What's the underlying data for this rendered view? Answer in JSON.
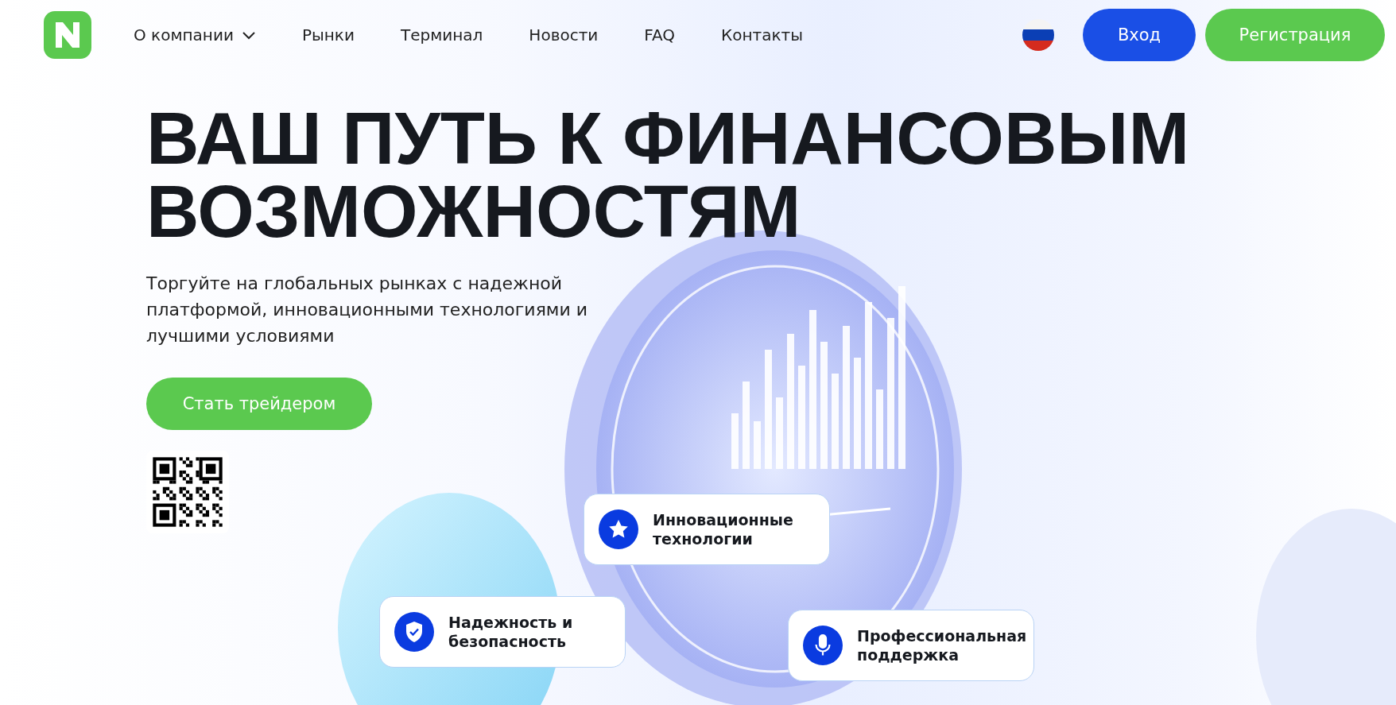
{
  "header": {
    "nav": [
      {
        "label": "О компании",
        "kind": "dropdown"
      },
      {
        "label": "Рынки",
        "kind": "link"
      },
      {
        "label": "Терминал",
        "kind": "link"
      },
      {
        "label": "Новости",
        "kind": "link"
      },
      {
        "label": "FAQ",
        "kind": "link"
      },
      {
        "label": "Контакты",
        "kind": "link"
      }
    ],
    "login": "Вход",
    "register": "Регистрация"
  },
  "hero": {
    "title_lines": [
      "ВАШ ПУТЬ К ФИНАНСОВЫМ",
      "ВОЗМОЖНОСТЯМ"
    ],
    "subtitle": "Торгуйте на глобальных рынках с надежной платформой, инновационными технологиями и лучшими условиями",
    "cta": "Стать трейдером"
  },
  "features": [
    {
      "kind": "star",
      "text": "Инновационные технологии"
    },
    {
      "kind": "shield",
      "text": "Надежность и безопасность"
    },
    {
      "kind": "mic",
      "text": "Профессиональная поддержка"
    }
  ]
}
